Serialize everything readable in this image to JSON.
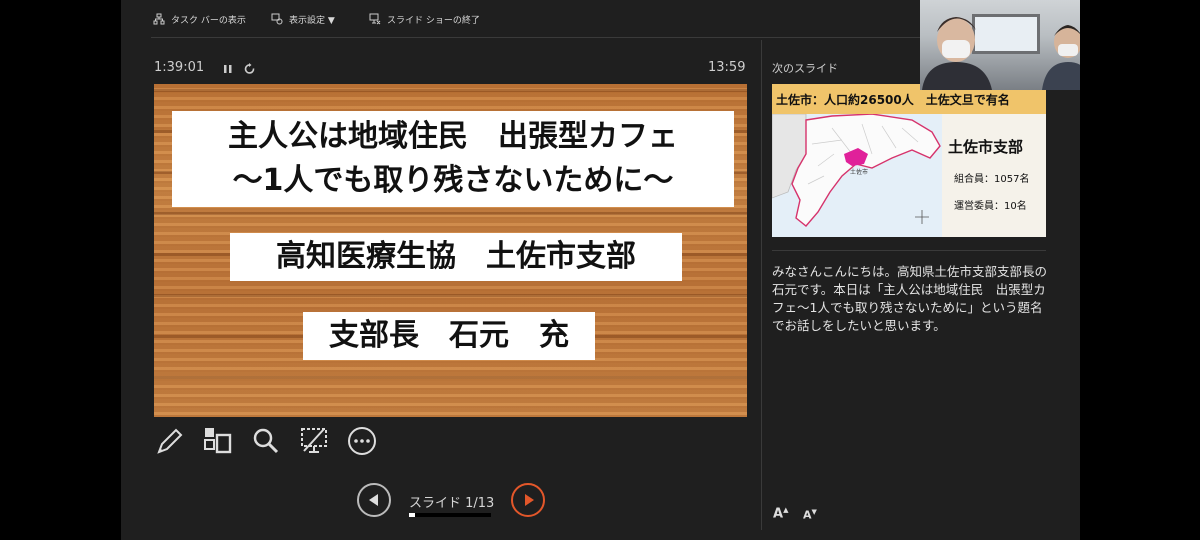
{
  "toolbar": {
    "taskbar_label": "タスク バーの表示",
    "display_settings_label": "表示設定 ▼",
    "end_show_label": "スライド ショーの終了"
  },
  "timers": {
    "elapsed": "1:39:01",
    "clock": "13:59"
  },
  "slide": {
    "title_line1": "主人公は地域住民　出張型カフェ",
    "title_line2": "～1人でも取り残さないために～",
    "org": "高知医療生協　土佐市支部",
    "presenter": "支部長　石元　充"
  },
  "tools": [
    "pen-icon",
    "all-slides-icon",
    "zoom-icon",
    "black-screen-icon",
    "more-options-icon"
  ],
  "navigation": {
    "counter": "スライド 1/13",
    "current": 1,
    "total": 13,
    "progress": 0.077
  },
  "next_slide": {
    "label": "次のスライド",
    "header": "土佐市：人口約26500人　土佐文旦で有名",
    "branch_title": "土佐市支部",
    "members": "組合員：1057名",
    "committee": "運営委員：10名",
    "map_label": "土佐市"
  },
  "notes": "みなさんこんにちは。高知県土佐市支部支部長の石元です。本日は「主人公は地域住民　出張型カフェ～1人でも取り残さないために」という題名でお話しをしたいと思います。",
  "font_controls": {
    "increase": "A",
    "decrease": "A"
  },
  "colors": {
    "accent": "#e3572a",
    "panel": "#1f1f1f",
    "thumb_header": "#f0c46a",
    "map_highlight": "#e0219a"
  }
}
